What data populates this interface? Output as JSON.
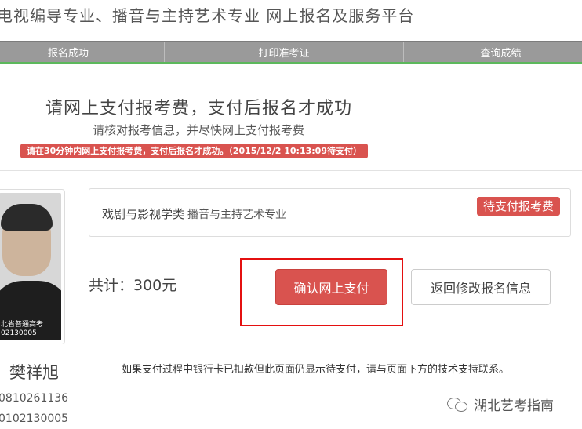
{
  "header": {
    "site_title": "电视编导专业、播音与主持艺术专业 网上报名及服务平台"
  },
  "nav": {
    "items": [
      {
        "label": "报名成功"
      },
      {
        "label": "打印准考证"
      },
      {
        "label": "查询成绩"
      }
    ]
  },
  "payment_notice": {
    "headline": "请网上支付报考费，支付后报名才成功",
    "subline": "请核对报考信息，并尽快网上支付报考费",
    "alert": "请在30分钟内网上支付报考费，支付后报名才成功。（2015/12/2 10:13:09待支付）"
  },
  "student": {
    "photo_caption_line1": "北省普通高考",
    "photo_caption_line2": "02130005",
    "name": "樊祥旭",
    "id_line1": "0810261136",
    "id_line2": "0102130005"
  },
  "exam": {
    "category": "戏剧与影视学类",
    "major": "播音与主持艺术专业",
    "status": "待支付报考费"
  },
  "order": {
    "total_label": "共计：300元",
    "confirm_label": "确认网上支付",
    "back_label": "返回修改报名信息"
  },
  "help": {
    "text": "如果支付过程中银行卡已扣款但此页面仍显示待支付，请与页面下方的技术支持联系。"
  },
  "watermark": {
    "text": "湖北艺考指南"
  },
  "colors": {
    "accent_red": "#d9534f",
    "nav_gray": "#9a9a9a",
    "nav_underline": "#5cb85c",
    "highlight_red": "#e41010"
  }
}
